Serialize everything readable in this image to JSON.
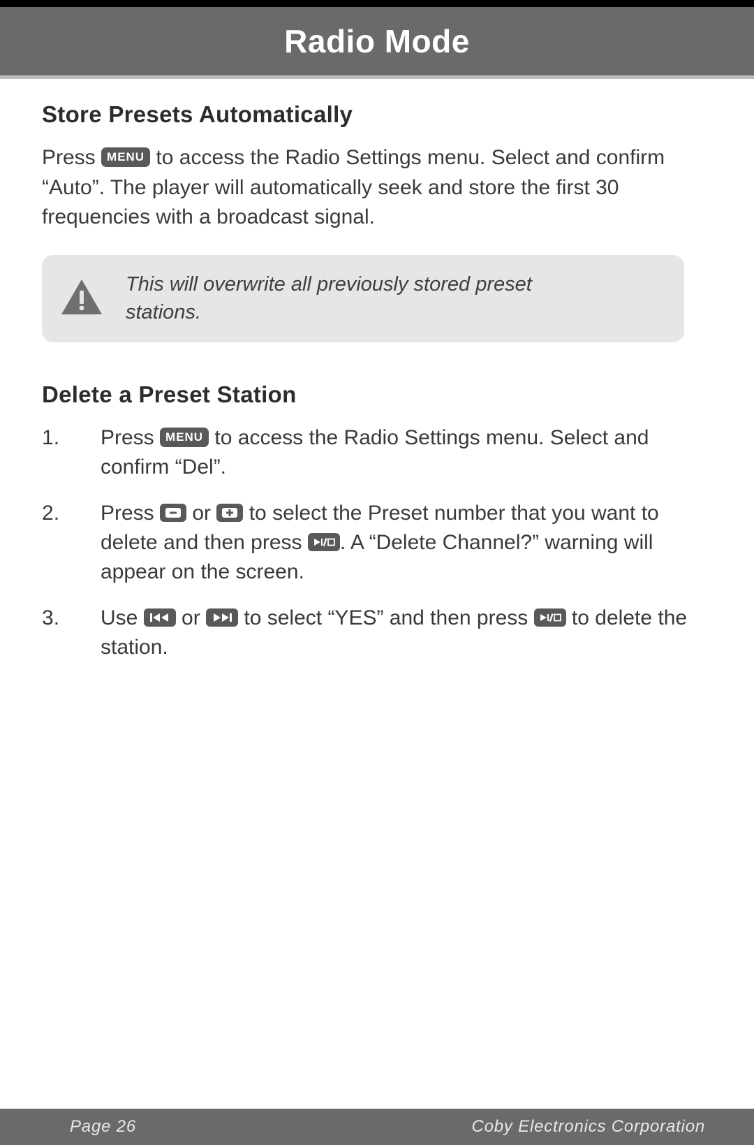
{
  "header": {
    "title": "Radio Mode"
  },
  "sections": {
    "store": {
      "heading": "Store Presets Automatically",
      "p1_a": "Press ",
      "p1_b": " to access the Radio Settings menu. Select and confirm “Auto”. The player will automatically seek and store the first 30 frequencies with a broadcast signal.",
      "warning": "This will overwrite all previously stored preset stations."
    },
    "delete": {
      "heading": "Delete a Preset Station",
      "s1_a": "Press ",
      "s1_b": " to access the Radio Settings menu. Select and confirm “Del”.",
      "s2_a": "Press ",
      "s2_b": " or ",
      "s2_c": " to select the Preset number that you want to delete and then press ",
      "s2_d": ". A “Delete Channel?” warning will appear on the screen.",
      "s3_a": "Use ",
      "s3_b": " or ",
      "s3_c": " to select “YES” and then press ",
      "s3_d": " to delete the station."
    }
  },
  "buttons": {
    "menu": "MENU"
  },
  "footer": {
    "page": "Page 26",
    "company": "Coby Electronics Corporation"
  }
}
